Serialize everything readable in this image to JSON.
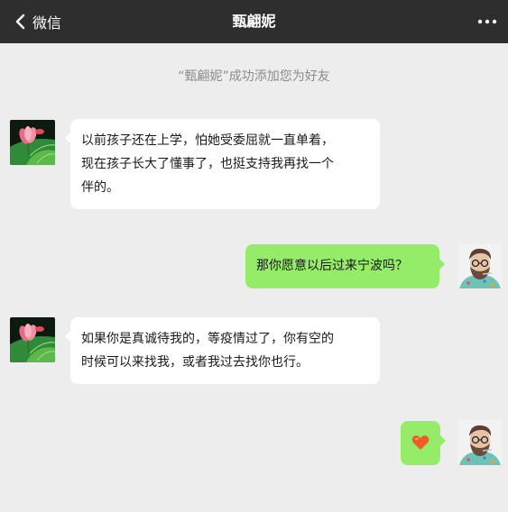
{
  "nav": {
    "back_label": "微信",
    "title": "甄翩妮",
    "back_icon": "chevron-left-icon",
    "more_icon": "more-dots-icon"
  },
  "system_notice": "“甄翩妮”成功添加您为好友",
  "messages": [
    {
      "side": "left",
      "sender": "contact",
      "lines": [
        "以前孩子还在上学，怕她受委屈就一直单着，",
        "现在孩子长大了懂事了，也挺支持我再找一个",
        "伴的。"
      ]
    },
    {
      "side": "right",
      "sender": "me",
      "lines": [
        "那你愿意以后过来宁波吗？"
      ]
    },
    {
      "side": "left",
      "sender": "contact",
      "lines": [
        "如果你是真诚待我的，等疫情过了，你有空的",
        "时候可以来找我，或者我过去找你也行。"
      ]
    },
    {
      "side": "right",
      "sender": "me",
      "emoji": "heart-icon"
    }
  ],
  "colors": {
    "nav_bg": "#2e2e2e",
    "chat_bg": "#ededed",
    "my_bubble": "#95ec69",
    "their_bubble": "#ffffff",
    "heart": "#f05a28"
  }
}
